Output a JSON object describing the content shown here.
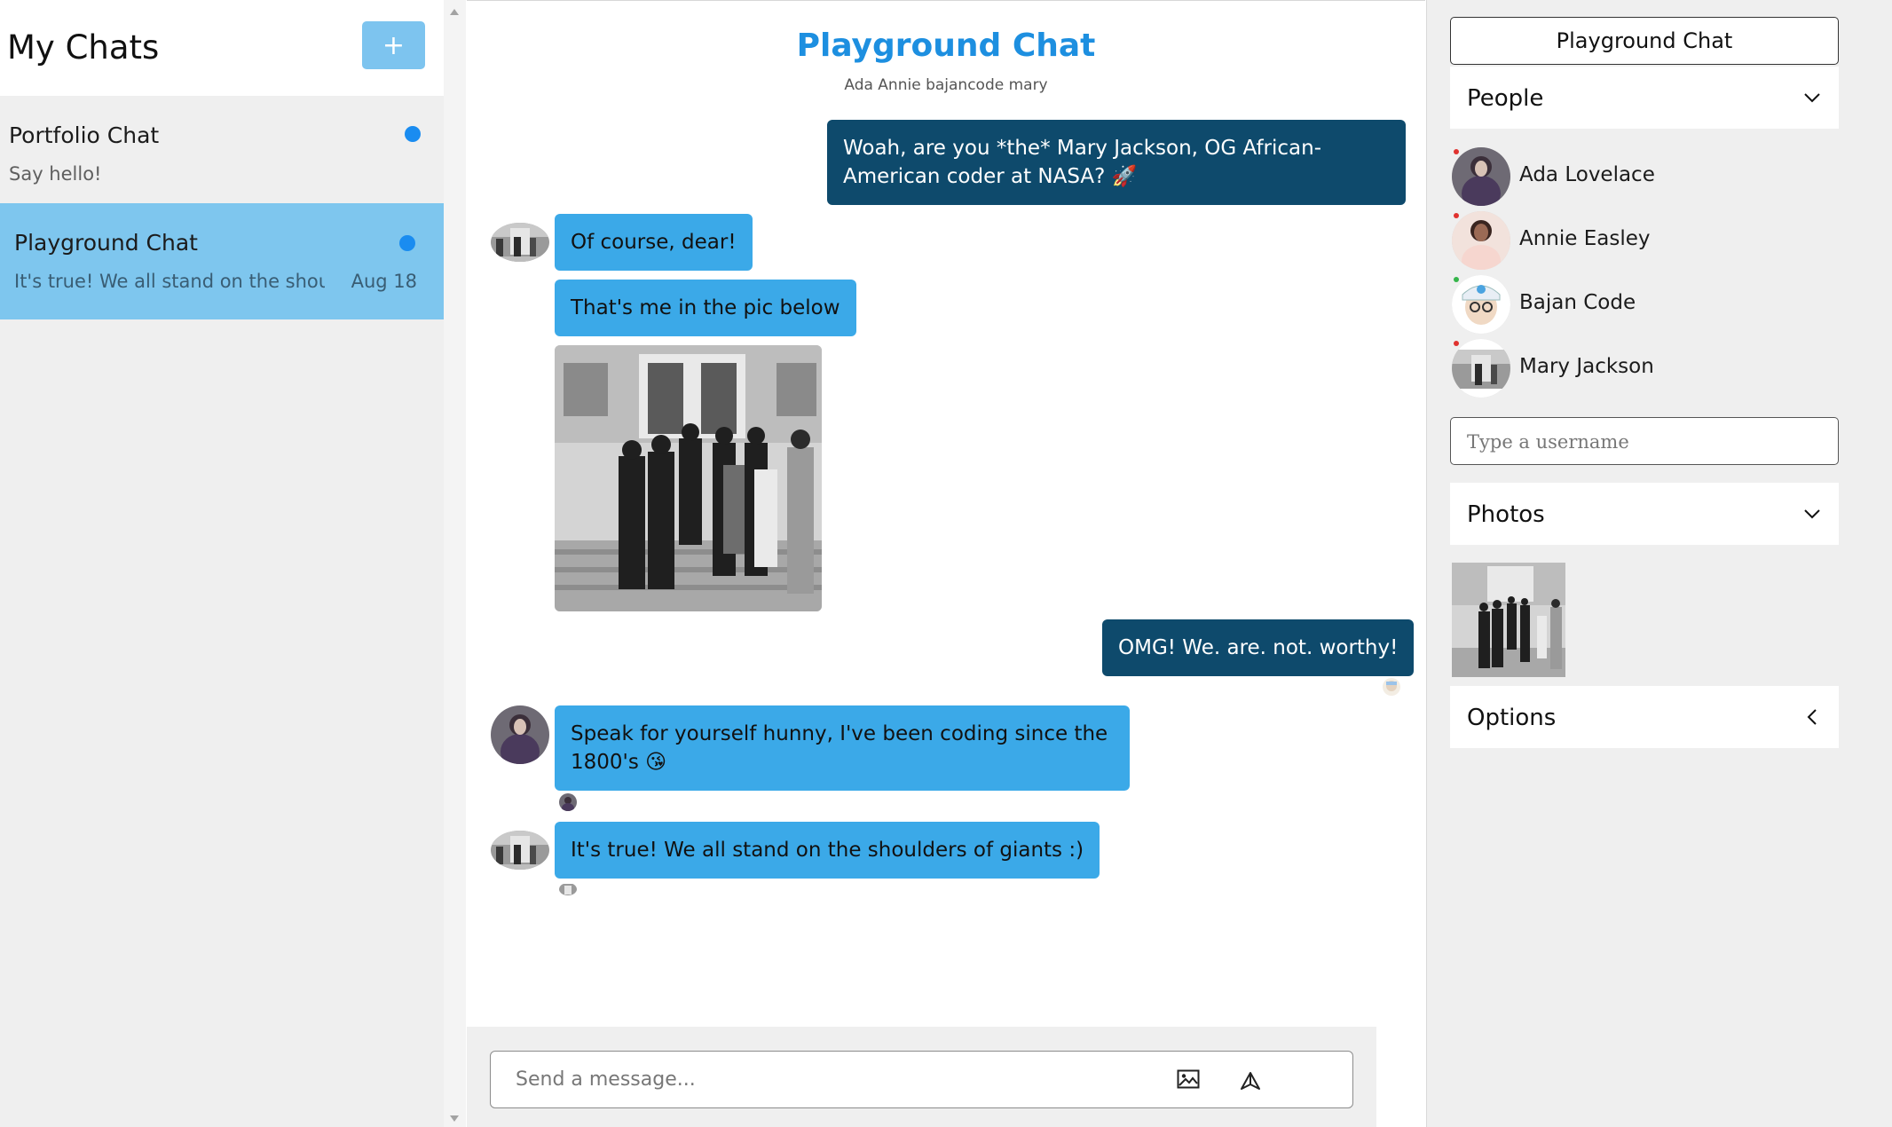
{
  "sidebar": {
    "title": "My Chats",
    "new_chat_icon": "+",
    "chats": [
      {
        "name": "Portfolio Chat",
        "preview": "Say hello!",
        "date": "",
        "unread": true
      },
      {
        "name": "Playground Chat",
        "preview": "It's true! We all stand on the shoul",
        "date": "Aug 18",
        "unread": true,
        "active": true
      }
    ]
  },
  "chat": {
    "title": "Playground Chat",
    "members": "Ada Annie bajancode mary",
    "messages": [
      {
        "from": "me",
        "text": "Woah, are you *the* Mary Jackson, OG African-American coder at NASA? 🚀"
      },
      {
        "from": "mary",
        "text": "Of course, dear!"
      },
      {
        "from": "mary",
        "text": "That's me in the pic below"
      },
      {
        "from": "mary",
        "type": "image",
        "alt": "group photo"
      },
      {
        "from": "me",
        "text": "OMG! We. are. not. worthy!"
      },
      {
        "from": "ada",
        "text": "Speak for yourself hunny, I've been coding since the 1800's 😘"
      },
      {
        "from": "mary",
        "text": "It's true! We all stand on the shoulders of giants :)"
      }
    ],
    "composer": {
      "placeholder": "Send a message...",
      "image_icon": "image-icon",
      "send_icon": "send-icon"
    }
  },
  "panel": {
    "title": "Playground Chat",
    "people_label": "People",
    "people": [
      {
        "name": "Ada Lovelace",
        "status_color": "#e0322f"
      },
      {
        "name": "Annie Easley",
        "status_color": "#e0322f"
      },
      {
        "name": "Bajan Code",
        "status_color": "#35b54a"
      },
      {
        "name": "Mary Jackson",
        "status_color": "#e0322f"
      }
    ],
    "username_placeholder": "Type a username",
    "photos_label": "Photos",
    "options_label": "Options"
  },
  "colors": {
    "accent": "#1d8fe0",
    "bubble_theirs": "#3ba9e8",
    "bubble_mine": "#0e4a6c",
    "active_chat": "#7ec6ee",
    "unread_dot": "#1a8cf0"
  }
}
